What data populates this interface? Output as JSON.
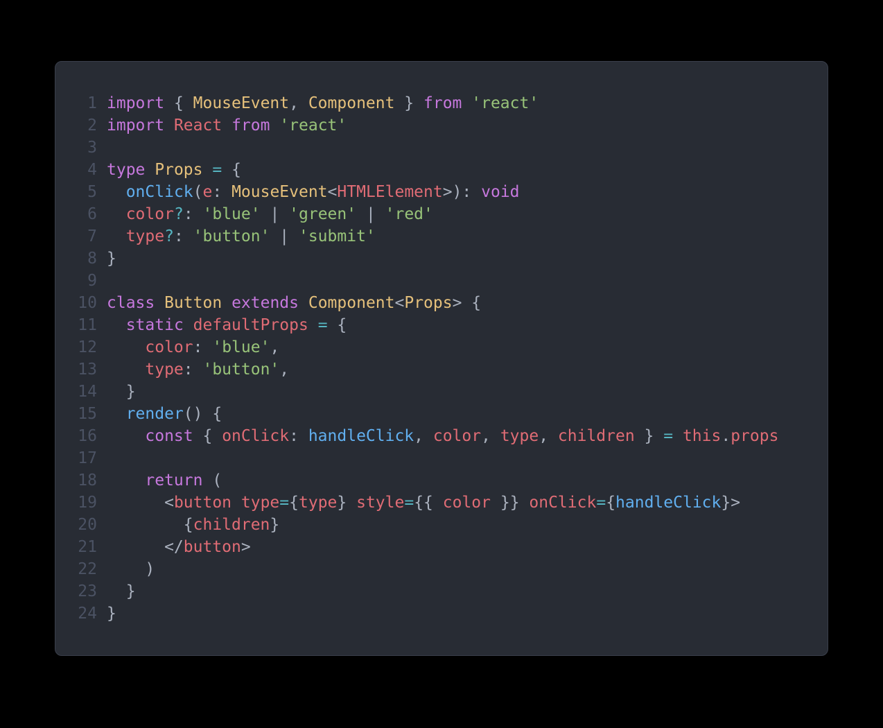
{
  "lines": [
    {
      "n": 1,
      "tokens": [
        [
          "kw",
          "import"
        ],
        [
          "def",
          " { "
        ],
        [
          "id-y",
          "MouseEvent"
        ],
        [
          "def",
          ", "
        ],
        [
          "id-y",
          "Component"
        ],
        [
          "def",
          " } "
        ],
        [
          "kw",
          "from"
        ],
        [
          "def",
          " "
        ],
        [
          "str",
          "'react'"
        ]
      ]
    },
    {
      "n": 2,
      "tokens": [
        [
          "kw",
          "import"
        ],
        [
          "def",
          " "
        ],
        [
          "id-r",
          "React"
        ],
        [
          "def",
          " "
        ],
        [
          "kw",
          "from"
        ],
        [
          "def",
          " "
        ],
        [
          "str",
          "'react'"
        ]
      ]
    },
    {
      "n": 3,
      "tokens": [
        [
          "def",
          ""
        ]
      ]
    },
    {
      "n": 4,
      "tokens": [
        [
          "kw",
          "type"
        ],
        [
          "def",
          " "
        ],
        [
          "id-y",
          "Props"
        ],
        [
          "def",
          " "
        ],
        [
          "op",
          "="
        ],
        [
          "def",
          " {"
        ]
      ]
    },
    {
      "n": 5,
      "tokens": [
        [
          "def",
          "  "
        ],
        [
          "id-b",
          "onClick"
        ],
        [
          "def",
          "("
        ],
        [
          "id-r",
          "e"
        ],
        [
          "def",
          ": "
        ],
        [
          "id-y",
          "MouseEvent"
        ],
        [
          "def",
          "<"
        ],
        [
          "id-r",
          "HTMLElement"
        ],
        [
          "def",
          ">): "
        ],
        [
          "kw",
          "void"
        ]
      ]
    },
    {
      "n": 6,
      "tokens": [
        [
          "def",
          "  "
        ],
        [
          "id-r",
          "color"
        ],
        [
          "op",
          "?"
        ],
        [
          "def",
          ": "
        ],
        [
          "str",
          "'blue'"
        ],
        [
          "def",
          " | "
        ],
        [
          "str",
          "'green'"
        ],
        [
          "def",
          " | "
        ],
        [
          "str",
          "'red'"
        ]
      ]
    },
    {
      "n": 7,
      "tokens": [
        [
          "def",
          "  "
        ],
        [
          "id-r",
          "type"
        ],
        [
          "op",
          "?"
        ],
        [
          "def",
          ": "
        ],
        [
          "str",
          "'button'"
        ],
        [
          "def",
          " | "
        ],
        [
          "str",
          "'submit'"
        ]
      ]
    },
    {
      "n": 8,
      "tokens": [
        [
          "def",
          "}"
        ]
      ]
    },
    {
      "n": 9,
      "tokens": [
        [
          "def",
          ""
        ]
      ]
    },
    {
      "n": 10,
      "tokens": [
        [
          "kw",
          "class"
        ],
        [
          "def",
          " "
        ],
        [
          "id-y",
          "Button"
        ],
        [
          "def",
          " "
        ],
        [
          "kw",
          "extends"
        ],
        [
          "def",
          " "
        ],
        [
          "id-y",
          "Component"
        ],
        [
          "def",
          "<"
        ],
        [
          "id-y",
          "Props"
        ],
        [
          "def",
          "> {"
        ]
      ]
    },
    {
      "n": 11,
      "tokens": [
        [
          "def",
          "  "
        ],
        [
          "kw",
          "static"
        ],
        [
          "def",
          " "
        ],
        [
          "id-r",
          "defaultProps"
        ],
        [
          "def",
          " "
        ],
        [
          "op",
          "="
        ],
        [
          "def",
          " {"
        ]
      ]
    },
    {
      "n": 12,
      "tokens": [
        [
          "def",
          "    "
        ],
        [
          "id-r",
          "color"
        ],
        [
          "def",
          ": "
        ],
        [
          "str",
          "'blue'"
        ],
        [
          "def",
          ","
        ]
      ]
    },
    {
      "n": 13,
      "tokens": [
        [
          "def",
          "    "
        ],
        [
          "id-r",
          "type"
        ],
        [
          "def",
          ": "
        ],
        [
          "str",
          "'button'"
        ],
        [
          "def",
          ","
        ]
      ]
    },
    {
      "n": 14,
      "tokens": [
        [
          "def",
          "  }"
        ]
      ]
    },
    {
      "n": 15,
      "tokens": [
        [
          "def",
          "  "
        ],
        [
          "id-b",
          "render"
        ],
        [
          "def",
          "() {"
        ]
      ]
    },
    {
      "n": 16,
      "tokens": [
        [
          "def",
          "    "
        ],
        [
          "kw",
          "const"
        ],
        [
          "def",
          " { "
        ],
        [
          "id-r",
          "onClick"
        ],
        [
          "def",
          ": "
        ],
        [
          "id-b",
          "handleClick"
        ],
        [
          "def",
          ", "
        ],
        [
          "id-r",
          "color"
        ],
        [
          "def",
          ", "
        ],
        [
          "id-r",
          "type"
        ],
        [
          "def",
          ", "
        ],
        [
          "id-r",
          "children"
        ],
        [
          "def",
          " } "
        ],
        [
          "op",
          "="
        ],
        [
          "def",
          " "
        ],
        [
          "kw2",
          "this"
        ],
        [
          "def",
          "."
        ],
        [
          "id-r",
          "props"
        ]
      ]
    },
    {
      "n": 17,
      "tokens": [
        [
          "def",
          ""
        ]
      ]
    },
    {
      "n": 18,
      "tokens": [
        [
          "def",
          "    "
        ],
        [
          "kw",
          "return"
        ],
        [
          "def",
          " ("
        ]
      ]
    },
    {
      "n": 19,
      "tokens": [
        [
          "def",
          "      <"
        ],
        [
          "tag",
          "button"
        ],
        [
          "def",
          " "
        ],
        [
          "id-r",
          "type"
        ],
        [
          "op",
          "="
        ],
        [
          "def",
          "{"
        ],
        [
          "id-r",
          "type"
        ],
        [
          "def",
          "} "
        ],
        [
          "id-r",
          "style"
        ],
        [
          "op",
          "="
        ],
        [
          "def",
          "{{ "
        ],
        [
          "id-r",
          "color"
        ],
        [
          "def",
          " }} "
        ],
        [
          "id-r",
          "onClick"
        ],
        [
          "op",
          "="
        ],
        [
          "def",
          "{"
        ],
        [
          "id-b",
          "handleClick"
        ],
        [
          "def",
          "}>"
        ]
      ]
    },
    {
      "n": 20,
      "tokens": [
        [
          "def",
          "        {"
        ],
        [
          "id-r",
          "children"
        ],
        [
          "def",
          "}"
        ]
      ]
    },
    {
      "n": 21,
      "tokens": [
        [
          "def",
          "      </"
        ],
        [
          "tag",
          "button"
        ],
        [
          "def",
          ">"
        ]
      ]
    },
    {
      "n": 22,
      "tokens": [
        [
          "def",
          "    )"
        ]
      ]
    },
    {
      "n": 23,
      "tokens": [
        [
          "def",
          "  }"
        ]
      ]
    },
    {
      "n": 24,
      "tokens": [
        [
          "def",
          "}"
        ]
      ]
    }
  ]
}
